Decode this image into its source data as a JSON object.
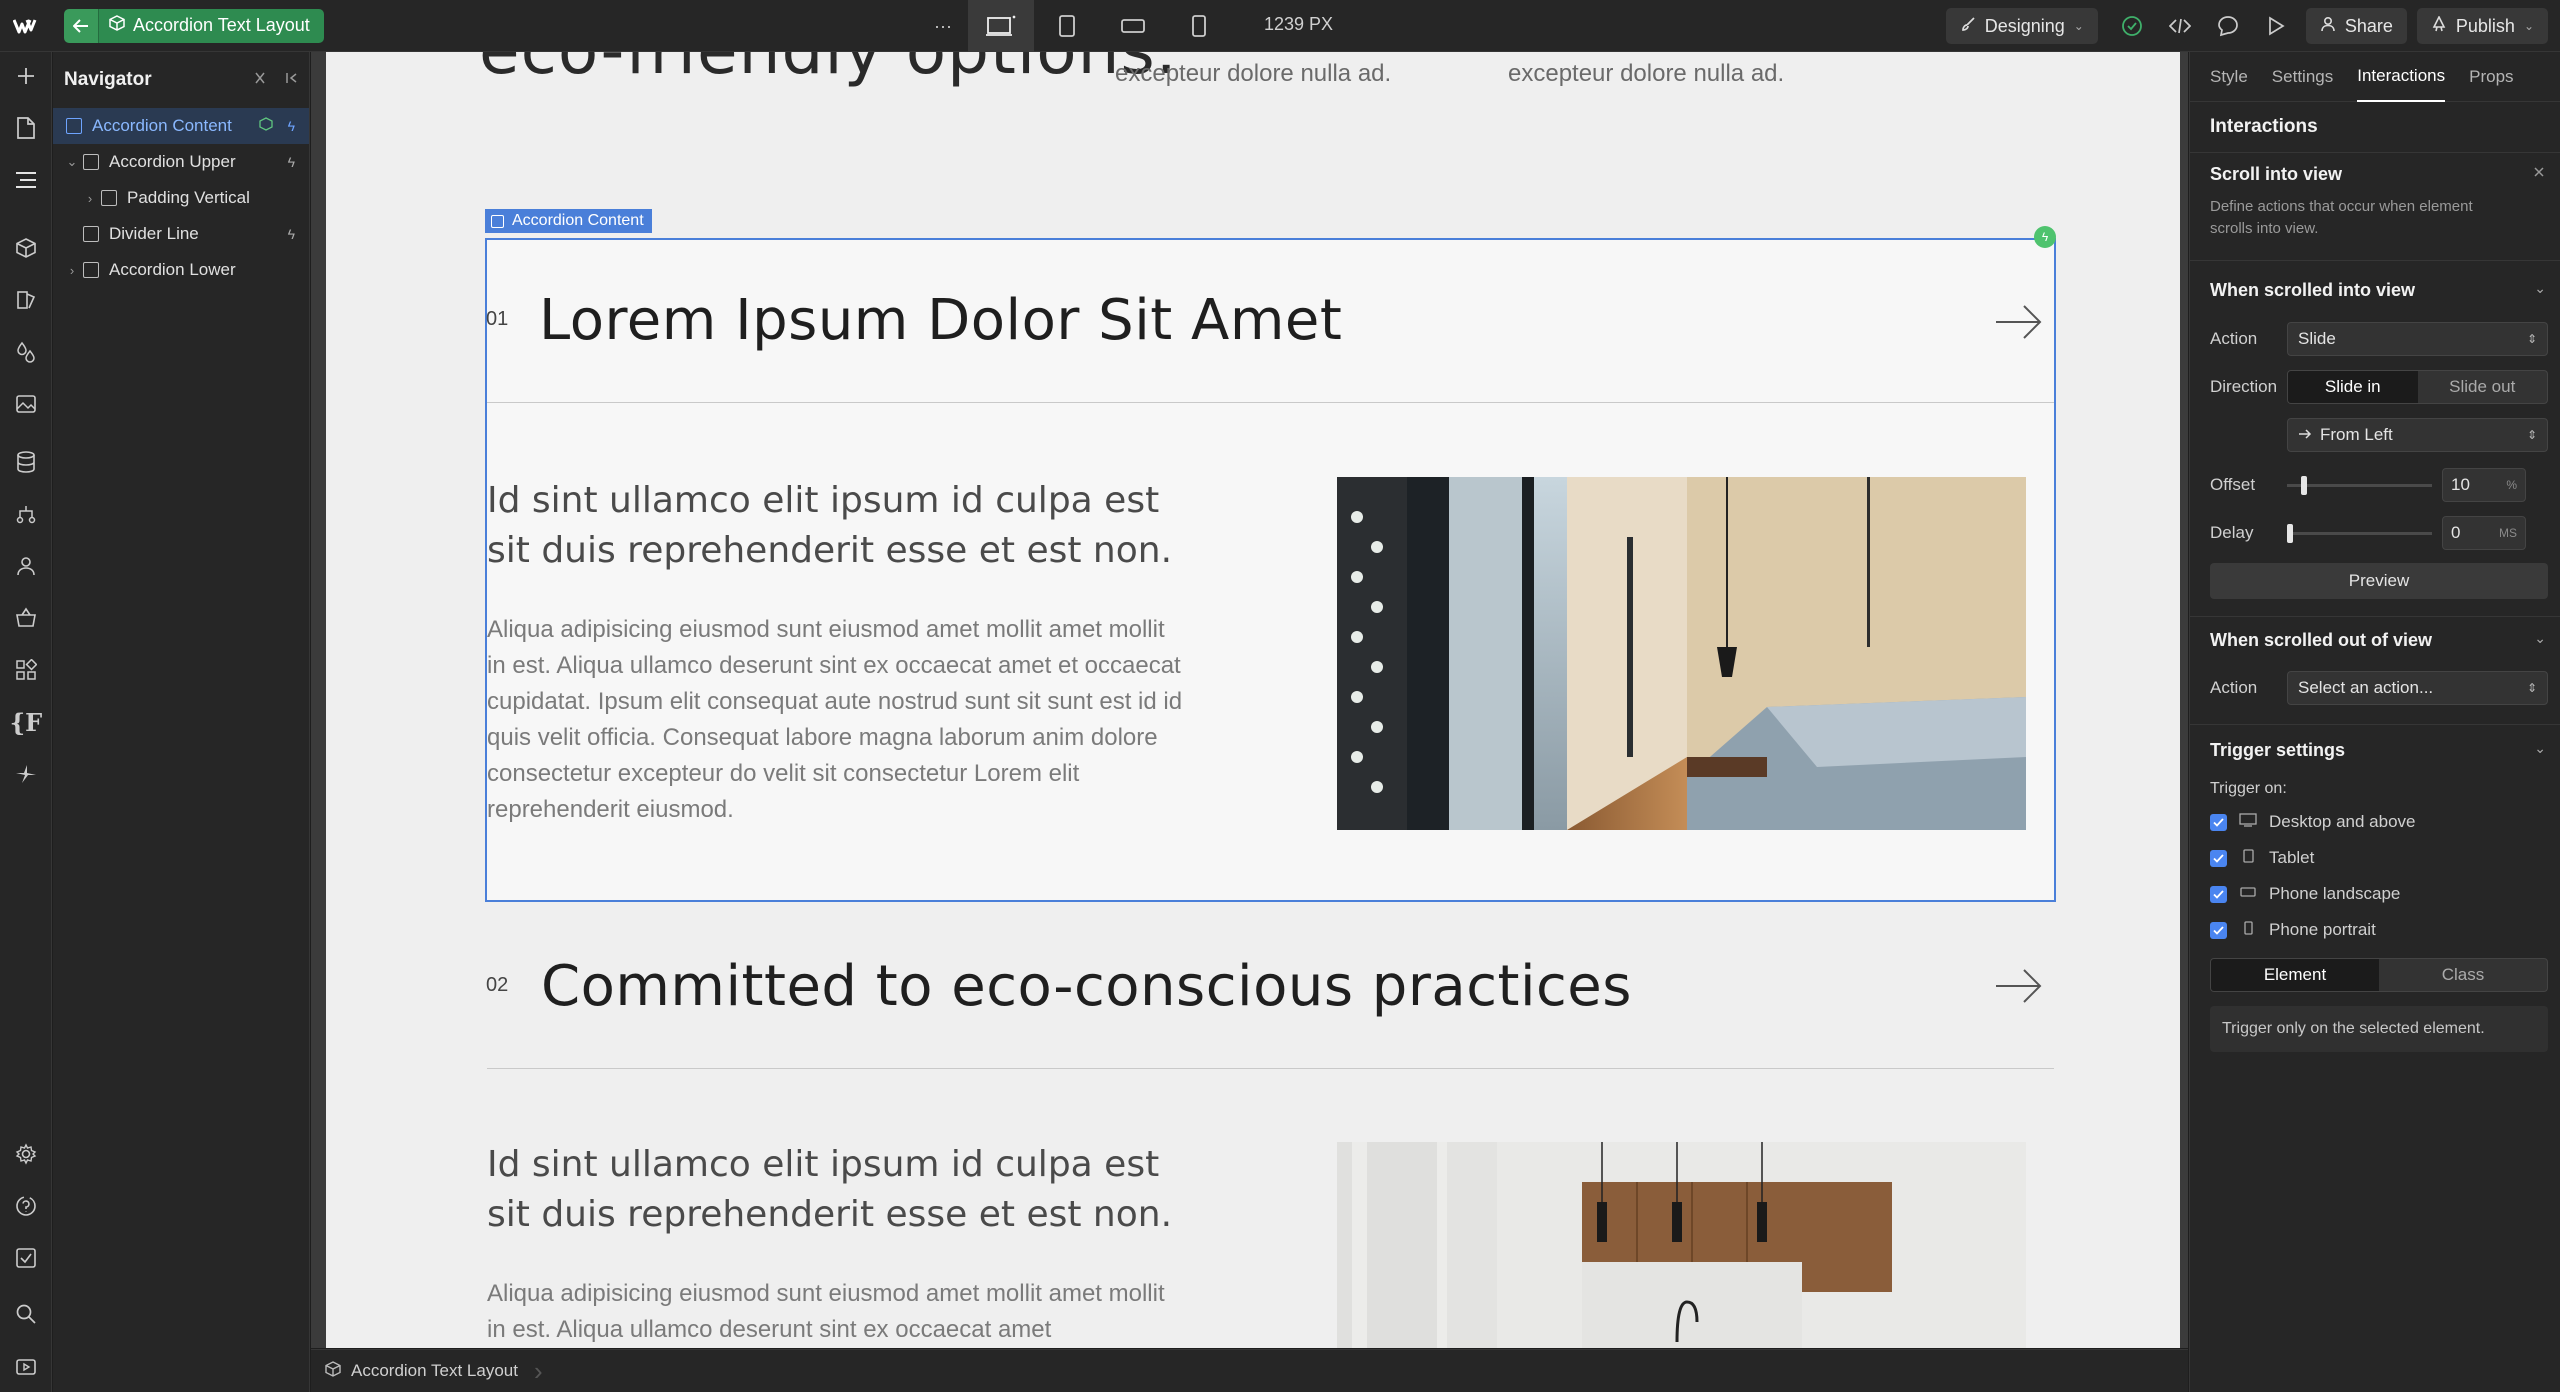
{
  "topbar": {
    "page_name": "Accordion Text Layout",
    "width_readout": "1239 PX",
    "mode_label": "Designing",
    "share_label": "Share",
    "publish_label": "Publish",
    "more_glyph": "···"
  },
  "navigator": {
    "title": "Navigator",
    "items": [
      {
        "label": "Accordion Content"
      },
      {
        "label": "Accordion Upper"
      },
      {
        "label": "Padding Vertical"
      },
      {
        "label": "Divider Line"
      },
      {
        "label": "Accordion Lower"
      }
    ]
  },
  "canvas": {
    "hero_partial": "eco-friendly options.",
    "top_caption_1": "excepteur dolore nulla ad.",
    "top_caption_2": "excepteur dolore nulla ad.",
    "selection_label": "Accordion Content",
    "items": [
      {
        "num": "01",
        "title": "Lorem Ipsum Dolor Sit Amet",
        "subtitle": "Id sint ullamco elit ipsum id culpa est sit duis reprehenderit esse et est non.",
        "body": "Aliqua adipisicing eiusmod sunt eiusmod amet mollit amet mollit in est. Aliqua ullamco deserunt sint ex occaecat amet et occaecat cupidatat. Ipsum elit consequat aute nostrud sunt sit sunt est id id quis velit officia. Consequat labore magna laborum anim dolore consectetur excepteur do velit sit consectetur Lorem elit reprehenderit eiusmod."
      },
      {
        "num": "02",
        "title": "Committed to eco-conscious practices",
        "subtitle": "Id sint ullamco elit ipsum id culpa est sit duis reprehenderit esse et est non.",
        "body": "Aliqua adipisicing eiusmod sunt eiusmod amet mollit amet mollit in est. Aliqua ullamco deserunt sint ex occaecat amet"
      }
    ]
  },
  "breadcrumb": {
    "label": "Accordion Text Layout"
  },
  "right_panel": {
    "tabs": [
      "Style",
      "Settings",
      "Interactions",
      "Props"
    ],
    "active_tab": "Interactions",
    "section_title": "Interactions",
    "trigger": {
      "title": "Scroll into view",
      "description": "Define actions that occur when element scrolls into view."
    },
    "scrolled_into_view": {
      "title": "When scrolled into view",
      "action_label": "Action",
      "action_value": "Slide",
      "direction_label": "Direction",
      "direction_options": [
        "Slide in",
        "Slide out"
      ],
      "direction_selected": "Slide in",
      "from_value": "From Left",
      "offset_label": "Offset",
      "offset_value": "10",
      "offset_unit": "%",
      "delay_label": "Delay",
      "delay_value": "0",
      "delay_unit": "MS",
      "preview_label": "Preview"
    },
    "scrolled_out_of_view": {
      "title": "When scrolled out of view",
      "action_label": "Action",
      "action_value": "Select an action..."
    },
    "trigger_settings": {
      "title": "Trigger settings",
      "trigger_on_label": "Trigger on:",
      "devices": [
        {
          "label": "Desktop and above",
          "checked": true
        },
        {
          "label": "Tablet",
          "checked": true
        },
        {
          "label": "Phone landscape",
          "checked": true
        },
        {
          "label": "Phone portrait",
          "checked": true
        }
      ],
      "scope_options": [
        "Element",
        "Class"
      ],
      "scope_selected": "Element",
      "note": "Trigger only on the selected element."
    }
  },
  "colors": {
    "accent_green": "#2e8b50",
    "selection_blue": "#4a7fd9",
    "checkbox_blue": "#4a85f0"
  }
}
